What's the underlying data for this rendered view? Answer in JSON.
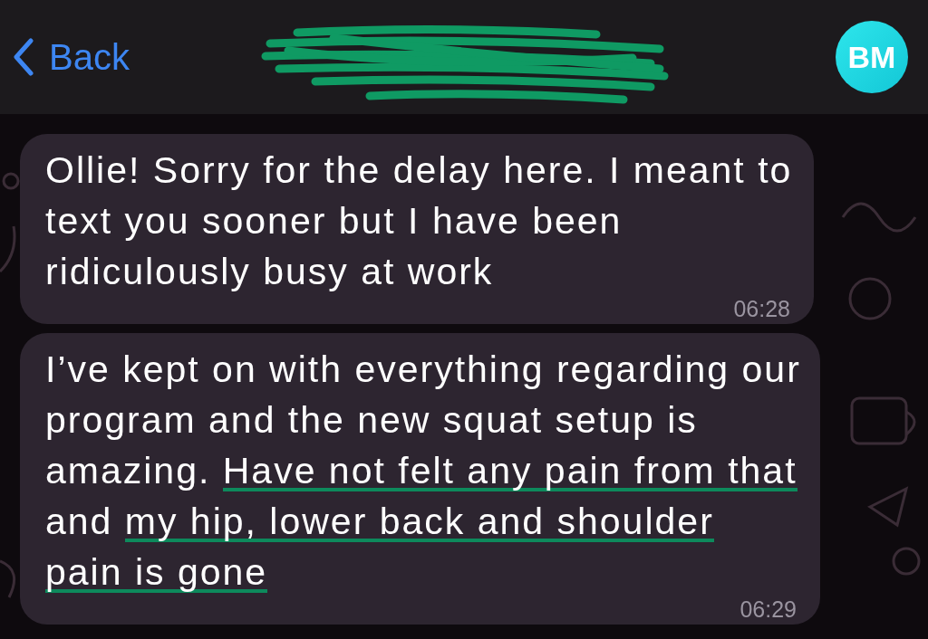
{
  "header": {
    "back_label": "Back",
    "avatar_initials": "BM",
    "name_redacted": true
  },
  "messages": [
    {
      "segments": [
        {
          "text": "Ollie! Sorry for the delay here. I meant to text you sooner but I have been ridiculously busy at work",
          "underlined": false
        }
      ],
      "time": "06:28"
    },
    {
      "segments": [
        {
          "text": "I’ve kept on with everything regarding our program and the new squat setup is amazing. ",
          "underlined": false
        },
        {
          "text": "Have not felt any pain from that",
          "underlined": true
        },
        {
          "text": " and ",
          "underlined": false
        },
        {
          "text": "my hip, lower back and shoulder pain is gone",
          "underlined": true
        }
      ],
      "time": "06:29"
    }
  ]
}
